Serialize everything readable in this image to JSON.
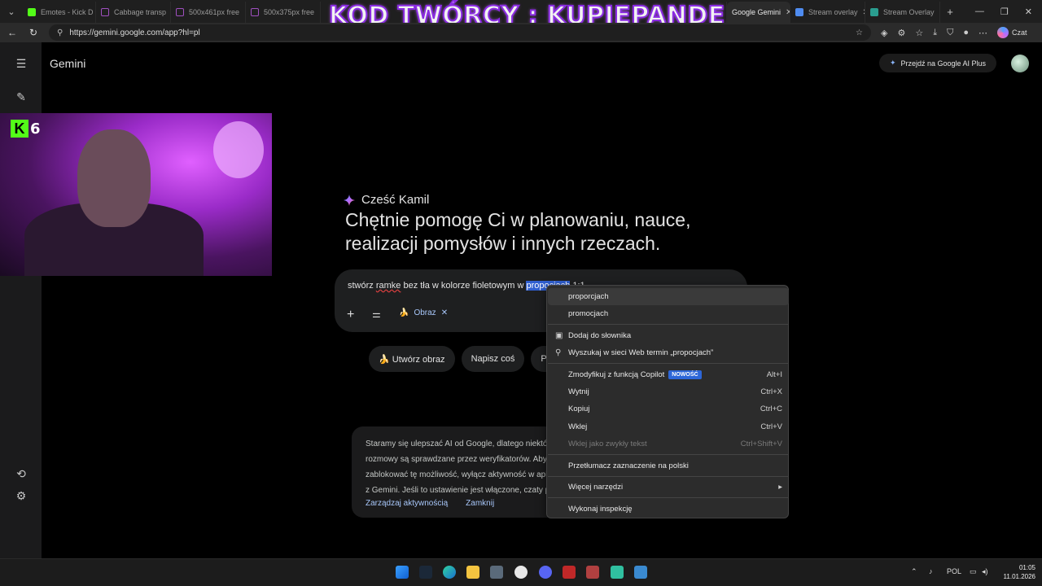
{
  "browser": {
    "tabs": [
      {
        "label": "Emotes - Kick D",
        "color": "#53fc18",
        "active": false
      },
      {
        "label": "Cabbage transp",
        "color": "#a050c0",
        "active": false
      },
      {
        "label": "500x461px free",
        "color": "#a050c0",
        "active": false
      },
      {
        "label": "500x375px free",
        "color": "#a050c0",
        "active": false
      },
      {
        "label": "Google Gemini",
        "color": "#4f8cf0",
        "active": true
      },
      {
        "label": "Stream overlay",
        "color": "#4f8cf0",
        "active": false
      },
      {
        "label": "Stream Overlay",
        "color": "#2a9d8f",
        "active": false
      }
    ],
    "url": "https://gemini.google.com/app?hl=pl",
    "copilot_label": "Czat"
  },
  "stream_overlay": {
    "title": "KOD TWÓRCY : KUPIEPANDE",
    "kick_count": "6"
  },
  "app": {
    "title": "Gemini",
    "upgrade_label": "Przejdź na Google AI Plus"
  },
  "greeting": {
    "hello": "Cześć Kamil",
    "headline": "Chętnie pomogę Ci w planowaniu, nauce, realizacji pomysłów i innych rzeczach."
  },
  "prompt": {
    "text_before": "stwórz ",
    "text_spell": "ramke",
    "text_middle": " bez tła w kolorze fioletowym w ",
    "text_selected": "propocjach",
    "text_after": " 1:1",
    "chip_label": "Obraz"
  },
  "suggestions": [
    "🍌 Utwórz obraz",
    "Napisz coś",
    "Pomóż mi"
  ],
  "notice": {
    "text": "Staramy się ulepszać AI od Google, dlatego niektóre rozmowy są sprawdzane przez weryfikatorów. Aby zablokować tę możliwość, wyłącz aktywność w aplikacjach z Gemini. Jeśli to ustawienie jest włączone, czaty powinny być sprawdzane lub wykorzystywane",
    "manage_label": "Zarządzaj aktywnością",
    "close_label": "Zamknij"
  },
  "context_menu": {
    "suggestion_1": "proporcjach",
    "suggestion_2": "promocjach",
    "add_dict": "Dodaj do słownika",
    "search_web": "Wyszukaj w sieci Web termin „propocjach”",
    "copilot": "Zmodyfikuj z funkcją Copilot",
    "copilot_badge": "NOWOŚĆ",
    "copilot_sc": "Alt+I",
    "cut": "Wytnij",
    "cut_sc": "Ctrl+X",
    "copy": "Kopiuj",
    "copy_sc": "Ctrl+C",
    "paste": "Wklej",
    "paste_sc": "Ctrl+V",
    "paste_plain": "Wklej jako zwykły tekst",
    "paste_plain_sc": "Ctrl+Shift+V",
    "translate": "Przetłumacz zaznaczenie na polski",
    "more_tools": "Więcej narzędzi",
    "inspect": "Wykonaj inspekcję"
  },
  "taskbar": {
    "lang": "POL",
    "time": "01:05",
    "date": "11.01.2026"
  }
}
